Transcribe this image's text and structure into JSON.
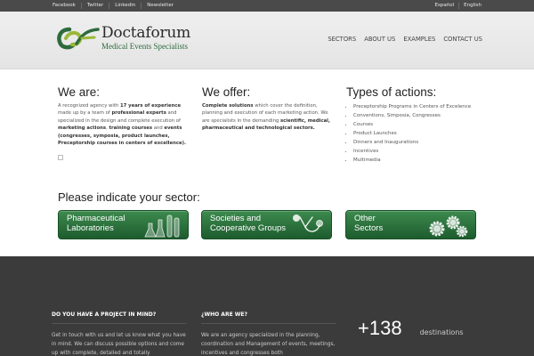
{
  "topbar": {
    "social": [
      "Facebook",
      "Twitter",
      "Linkedin",
      "Newsletter"
    ],
    "languages": [
      "Español",
      "English"
    ]
  },
  "brand": {
    "name": "Doctaforum",
    "tagline": "Medical Events Specialists",
    "accent": "#2e6b3c"
  },
  "nav": [
    "SECTORS",
    "ABOUT US",
    "EXAMPLES",
    "CONTACT US"
  ],
  "we_are": {
    "title": "We are:",
    "t1": "A recognized agency with ",
    "b1": "17 years of experience",
    "t2": " made up by a team of ",
    "b2": "professional experts",
    "t3": " and specialized in the design and complete execution of ",
    "b3": "marketing actions",
    "t4": ", ",
    "b4": "training courses",
    "t5": " and ",
    "b5": "events (congresses, symposia, product launches, Preceptorship courses in centers of excellence)."
  },
  "we_offer": {
    "title": "We offer:",
    "b1": "Complete solutions",
    "t1": " which cover the definition, planning and execution of each marketing action.  We are specialists in the demanding ",
    "b2": "scientific, medical, pharmaceutical and technological sectors."
  },
  "types": {
    "title": "Types of actions:",
    "items": [
      "Preceptorship Programs in Centers of Excelence",
      "Conventions, Simposia, Congresses",
      "Courses",
      "Product Launches",
      "Dinners and Inaugurations",
      "Incentives",
      "Multimedia"
    ]
  },
  "sectors": {
    "title": "Please indicate your sector:",
    "buttons": [
      {
        "line1": "Pharmaceutical",
        "line2": "Laboratories",
        "icon": "flasks-icon"
      },
      {
        "line1": "Societies and",
        "line2": "Cooperative Groups",
        "icon": "stethoscope-icon"
      },
      {
        "line1": "Other",
        "line2": "Sectors",
        "icon": "gears-icon"
      }
    ],
    "button_color": "#2a7040"
  },
  "footer": {
    "project": {
      "title": "DO YOU HAVE A PROJECT IN MIND?",
      "text": "Get in touch with us and let us know what you have in mind. We can discuss possible options and come up with complete, detailed and totally"
    },
    "who": {
      "title": "¿WHO ARE WE?",
      "text": "We are an agency specialized in the planning, coordination and Management of events, meetings, incentives and congresses both"
    },
    "stat": {
      "number": "+138",
      "label": "destinations"
    }
  }
}
